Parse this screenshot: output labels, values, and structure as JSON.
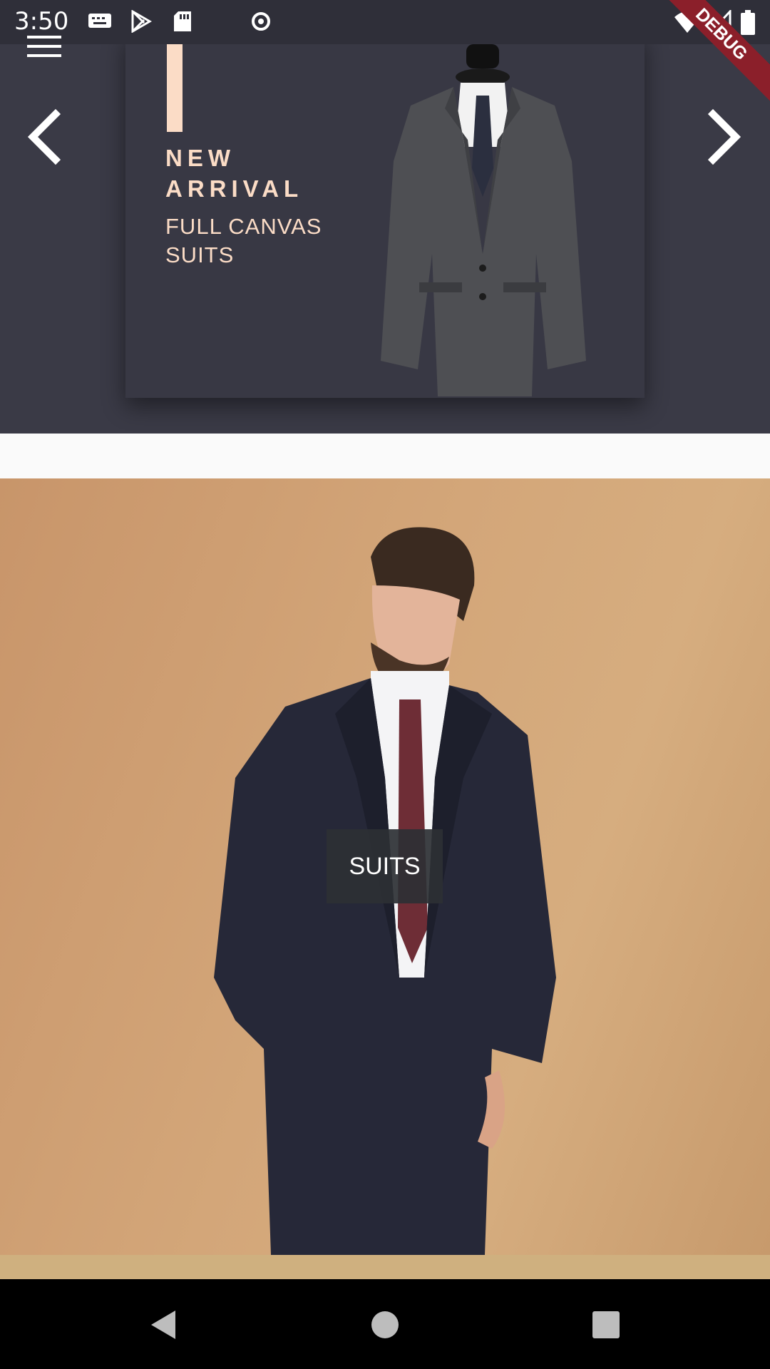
{
  "status_bar": {
    "time": "3:50",
    "icons": [
      "keyboard-icon",
      "play-store-icon",
      "sd-card-icon",
      "sync-icon",
      "wifi-icon",
      "signal-icon",
      "battery-icon"
    ]
  },
  "debug_banner": {
    "label": "DEBUG",
    "color": "#8b1f2a"
  },
  "hero": {
    "menu_icon": "hamburger-menu-icon",
    "prev_icon": "chevron-left-icon",
    "next_icon": "chevron-right-icon",
    "promo": {
      "headline_line1": "NEW",
      "headline_line2": "ARRIVAL",
      "subtitle_line1": "FULL CANVAS",
      "subtitle_line2": "SUITS",
      "accent_color": "#fbdcc6",
      "background_color": "#383844"
    }
  },
  "category": {
    "label": "SUITS",
    "background_color": "#d3a679"
  },
  "nav_bar": {
    "buttons": [
      "back-triangle-icon",
      "home-circle-icon",
      "recents-square-icon"
    ]
  }
}
